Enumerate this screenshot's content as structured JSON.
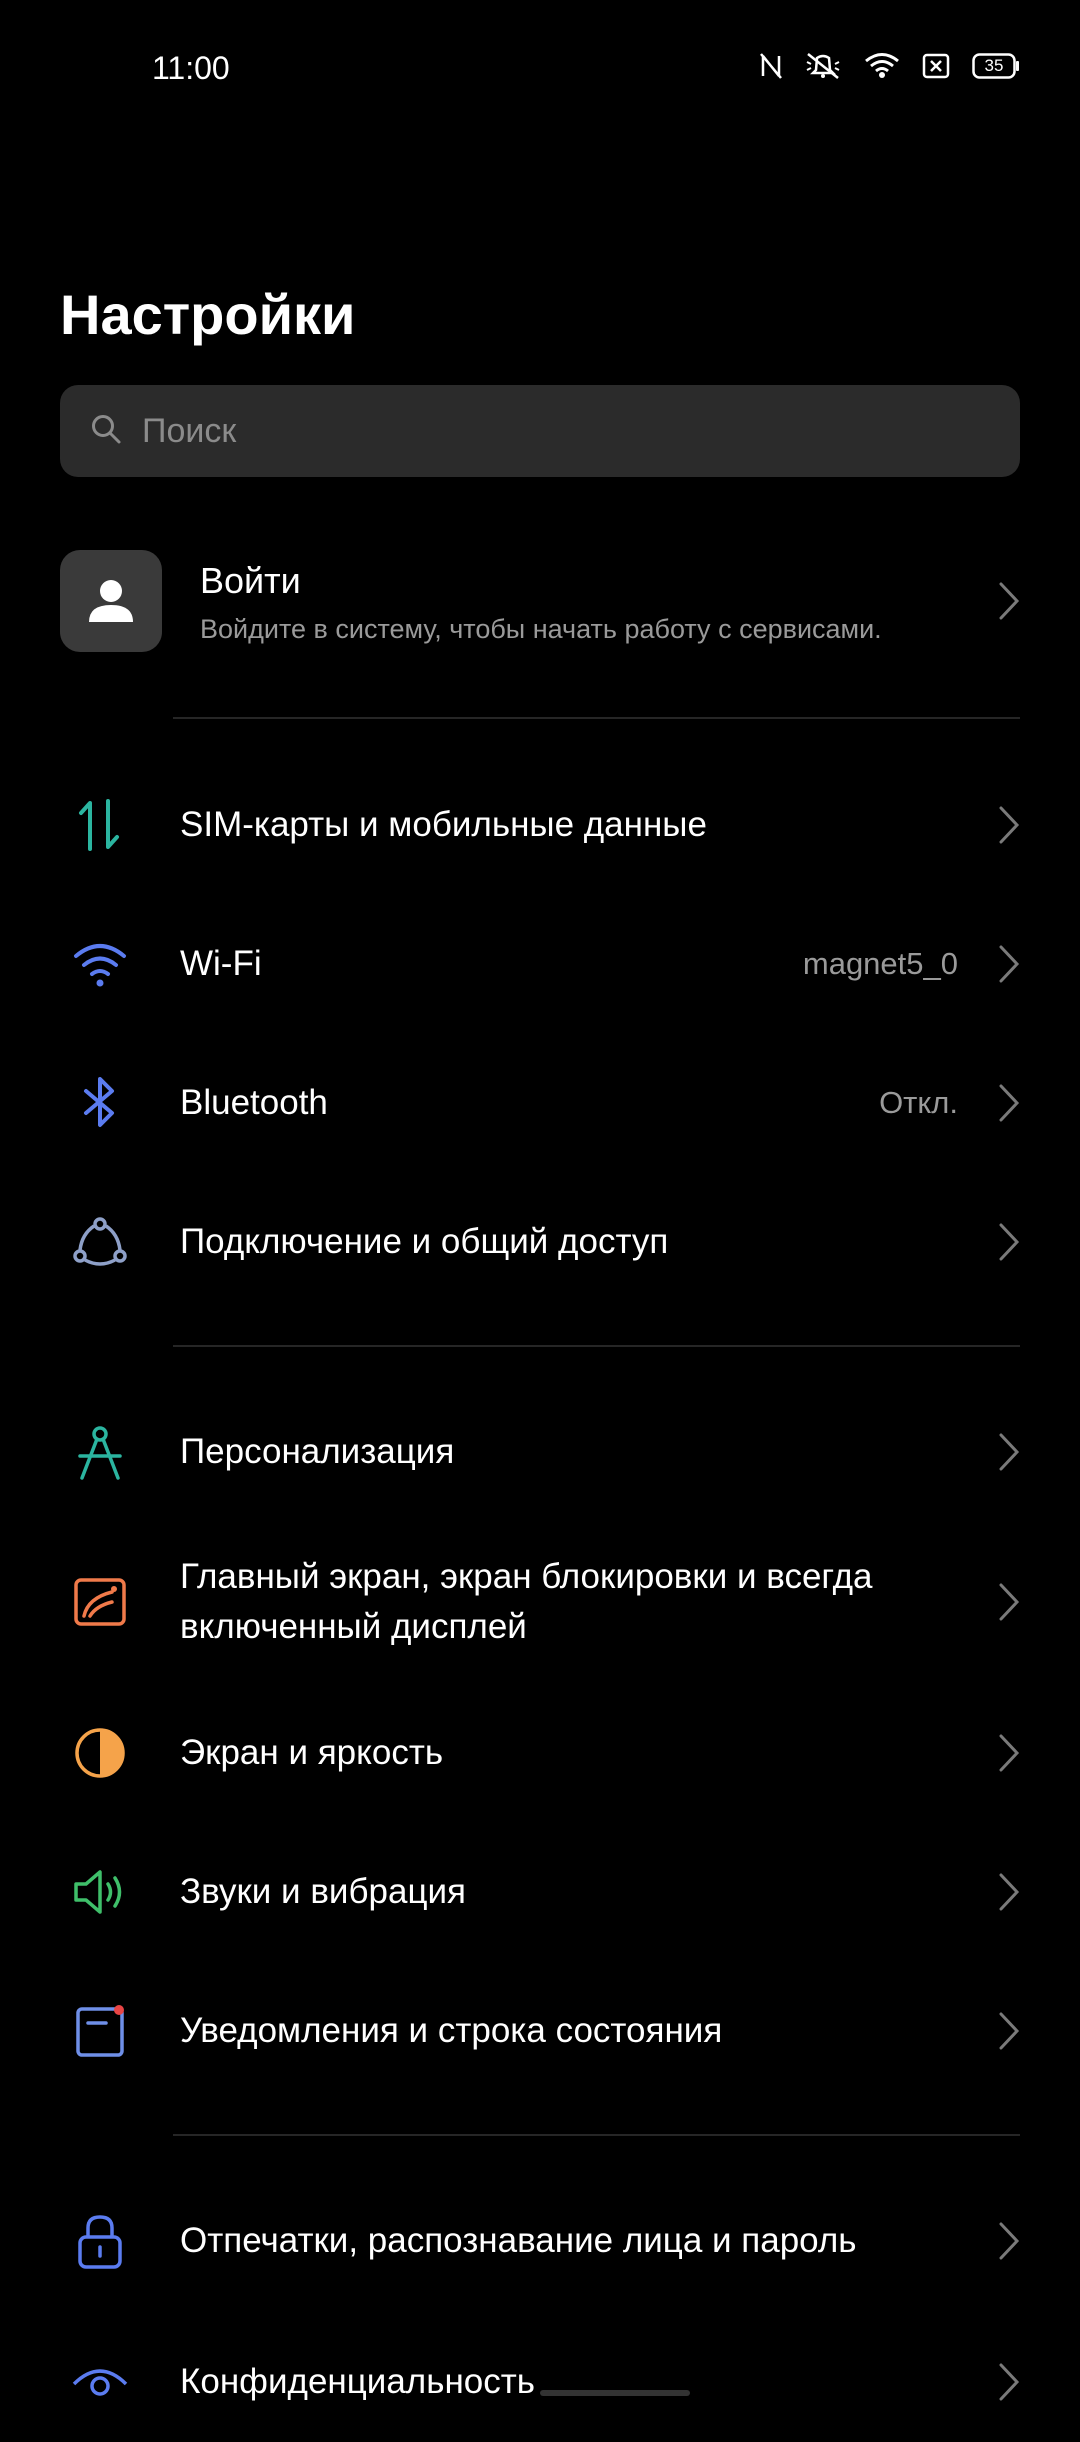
{
  "status_bar": {
    "time": "11:00",
    "battery": "35"
  },
  "page": {
    "title": "Настройки"
  },
  "search": {
    "placeholder": "Поиск"
  },
  "account": {
    "title": "Войти",
    "subtitle": "Войдите в систему, чтобы начать работу с сервисами."
  },
  "items": [
    {
      "label": "SIM-карты и мобильные данные",
      "value": ""
    },
    {
      "label": "Wi-Fi",
      "value": "magnet5_0"
    },
    {
      "label": "Bluetooth",
      "value": "Откл."
    },
    {
      "label": "Подключение и общий доступ",
      "value": ""
    },
    {
      "label": "Персонализация",
      "value": ""
    },
    {
      "label": "Главный экран, экран блокировки и всегда включенный дисплей",
      "value": ""
    },
    {
      "label": "Экран и яркость",
      "value": ""
    },
    {
      "label": "Звуки и вибрация",
      "value": ""
    },
    {
      "label": "Уведомления и строка состояния",
      "value": ""
    },
    {
      "label": "Отпечатки, распознавание лица и пароль",
      "value": ""
    },
    {
      "label": "Конфиденциальность",
      "value": ""
    }
  ],
  "colors": {
    "sim": "#2bb5a0",
    "wifi": "#5b7cf0",
    "bluetooth": "#5b7cf0",
    "connection": "#8ea0c8",
    "personalization": "#2bb5a0",
    "home": "#f07a4a",
    "display": "#f5a34a",
    "sound": "#3fbf6a",
    "notifications": "#6f8fe8",
    "security": "#5b7cf0",
    "privacy": "#5b7cf0"
  }
}
